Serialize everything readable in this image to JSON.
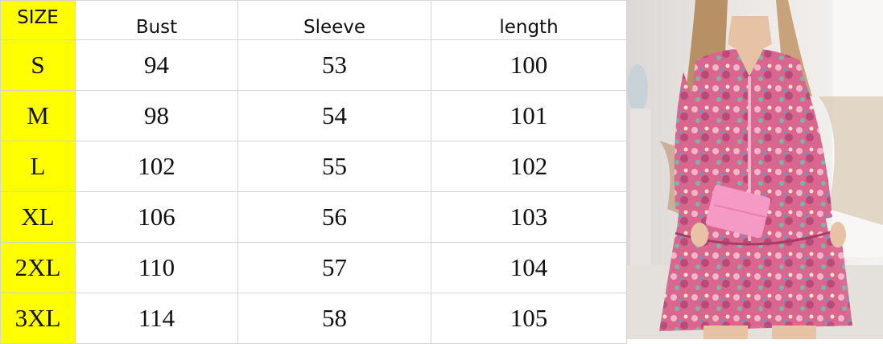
{
  "table": {
    "headers": [
      "SIZE",
      "Bust",
      "Sleeve",
      "length"
    ],
    "rows": [
      {
        "size": "S",
        "bust": "94",
        "sleeve": "53",
        "length": "100"
      },
      {
        "size": "M",
        "bust": "98",
        "sleeve": "54",
        "length": "101"
      },
      {
        "size": "L",
        "bust": "102",
        "sleeve": "55",
        "length": "102"
      },
      {
        "size": "XL",
        "bust": "106",
        "sleeve": "56",
        "length": "103"
      },
      {
        "size": "2XL",
        "bust": "110",
        "sleeve": "57",
        "length": "104"
      },
      {
        "size": "3XL",
        "bust": "114",
        "sleeve": "58",
        "length": "105"
      }
    ]
  },
  "colors": {
    "size_column": "#ffff00",
    "grid_line": "#d4d4d4",
    "dress_pink": "#d8668f",
    "clutch_pink": "#f49ac4"
  }
}
